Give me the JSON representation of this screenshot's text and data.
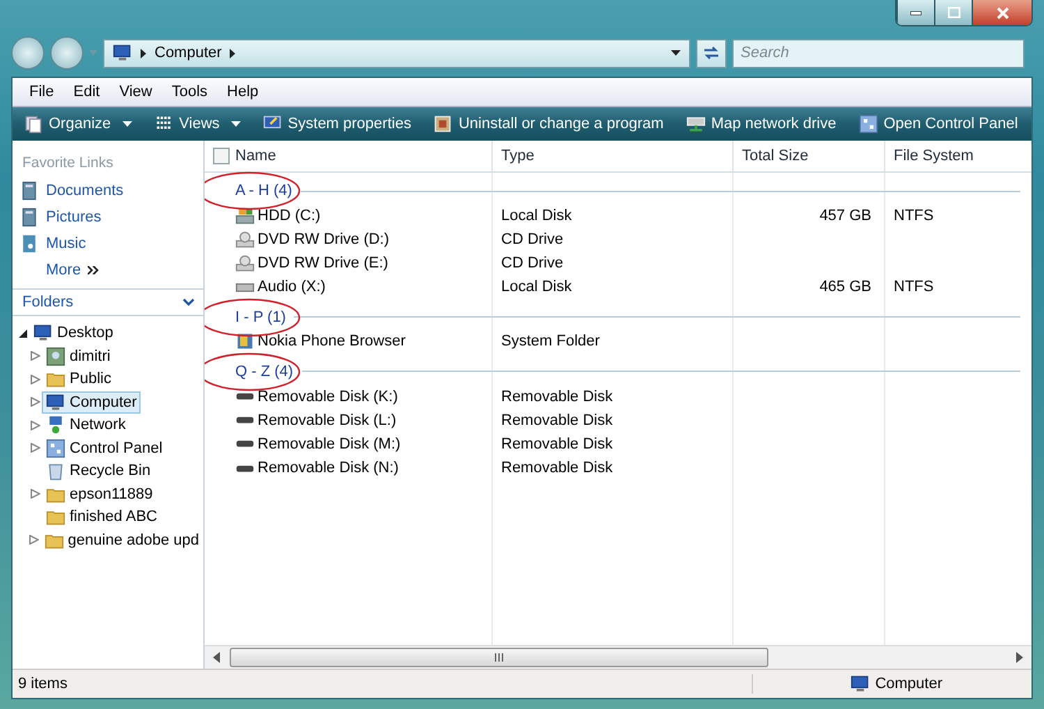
{
  "address_bar": {
    "path": [
      "Computer"
    ],
    "search": {
      "placeholder": "Search"
    }
  },
  "menu_bar": [
    "File",
    "Edit",
    "View",
    "Tools",
    "Help"
  ],
  "command_bar": [
    {
      "label": "Organize",
      "kind": "organize",
      "dropdown": true
    },
    {
      "label": "Views",
      "kind": "views",
      "dropdown": true
    },
    {
      "label": "System properties",
      "kind": "properties",
      "dropdown": false
    },
    {
      "label": "Uninstall or change a program",
      "kind": "uninstall",
      "dropdown": false
    },
    {
      "label": "Map network drive",
      "kind": "network-drive",
      "dropdown": false
    },
    {
      "label": "Open Control Panel",
      "kind": "control-panel",
      "dropdown": false
    }
  ],
  "favorite_links": {
    "title": "Favorite Links",
    "items": [
      {
        "label": "Documents",
        "kind": "documents"
      },
      {
        "label": "Pictures",
        "kind": "pictures"
      },
      {
        "label": "Music",
        "kind": "music"
      }
    ],
    "more": "More"
  },
  "folders": {
    "title": "Folders",
    "tree": [
      {
        "label": "Desktop",
        "kind": "desktop",
        "expanded": true,
        "selected": false,
        "children": [
          {
            "label": "dimitri",
            "kind": "user",
            "expanded": false,
            "selected": false
          },
          {
            "label": "Public",
            "kind": "folder",
            "expanded": false,
            "selected": false
          },
          {
            "label": "Computer",
            "kind": "computer",
            "expanded": false,
            "selected": true
          },
          {
            "label": "Network",
            "kind": "network",
            "expanded": false,
            "selected": false
          },
          {
            "label": "Control Panel",
            "kind": "control-panel",
            "expanded": false,
            "selected": false
          },
          {
            "label": "Recycle Bin",
            "kind": "recycle",
            "selected": false
          },
          {
            "label": "epson11889",
            "kind": "folder",
            "expanded": false,
            "selected": false
          },
          {
            "label": "finished ABC",
            "kind": "folder",
            "selected": false
          },
          {
            "label": "genuine adobe upd",
            "kind": "folder",
            "expanded": false,
            "selected": false
          }
        ]
      }
    ]
  },
  "table": {
    "select_all": {
      "checked": false
    },
    "columns": [
      "Name",
      "Type",
      "Total Size",
      "File System"
    ],
    "groups": [
      {
        "label": "A - H (4)",
        "circled": true,
        "rows": [
          {
            "name": "HDD (C:)",
            "kind": "hdd",
            "type": "Local Disk",
            "size": "457 GB",
            "fs": "NTFS"
          },
          {
            "name": "DVD RW Drive (D:)",
            "kind": "dvd",
            "type": "CD Drive"
          },
          {
            "name": "DVD RW Drive (E:)",
            "kind": "dvd",
            "type": "CD Drive"
          },
          {
            "name": "Audio (X:)",
            "kind": "disk",
            "type": "Local Disk",
            "size": "465 GB",
            "fs": "NTFS"
          }
        ]
      },
      {
        "label": "I - P (1)",
        "circled": true,
        "rows": [
          {
            "name": "Nokia Phone Browser",
            "kind": "phone",
            "type": "System Folder"
          }
        ]
      },
      {
        "label": "Q - Z (4)",
        "circled": true,
        "rows": [
          {
            "name": "Removable Disk (K:)",
            "kind": "removable",
            "type": "Removable Disk"
          },
          {
            "name": "Removable Disk (L:)",
            "kind": "removable",
            "type": "Removable Disk"
          },
          {
            "name": "Removable Disk (M:)",
            "kind": "removable",
            "type": "Removable Disk"
          },
          {
            "name": "Removable Disk (N:)",
            "kind": "removable",
            "type": "Removable Disk"
          }
        ]
      }
    ]
  },
  "status_bar": {
    "count": "9 items",
    "location": "Computer"
  }
}
